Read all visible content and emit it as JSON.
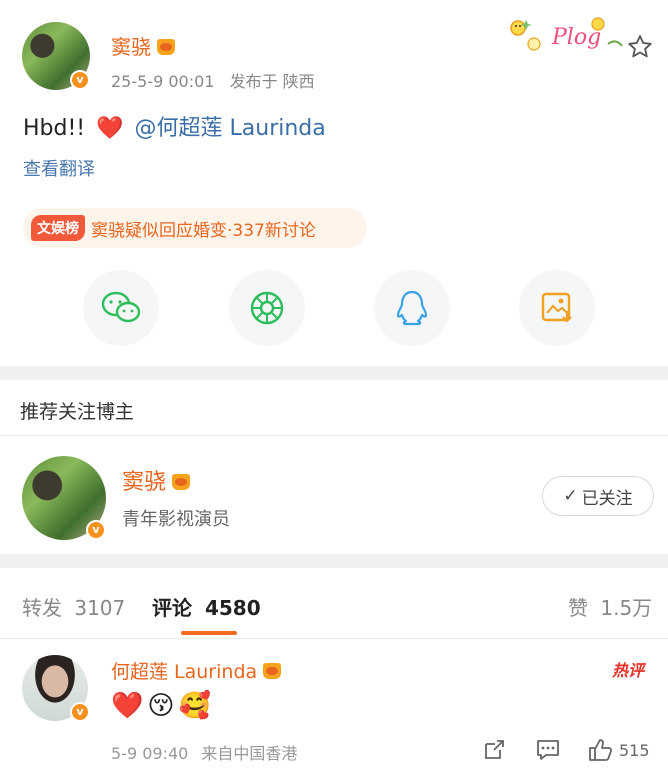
{
  "post": {
    "author_name": "窦骁",
    "time": "25-5-9 00:01",
    "location": "发布于 陕西",
    "content_text": "Hbd!!",
    "heart_glyph": "❤️",
    "mention": "@何超莲 Laurinda",
    "translate_label": "查看翻译",
    "hot_topic_tag": "文娱榜",
    "hot_topic_text": "窦骁疑似回应婚变·337新讨论",
    "verified_badge": "v",
    "sticker_text": "Plog",
    "icons": {
      "star": "star-icon",
      "wechat": "wechat-icon",
      "moments": "moments-icon",
      "qq": "qq-icon",
      "save_image": "save-image-icon"
    }
  },
  "recommend": {
    "title": "推荐关注博主",
    "blogger_name": "窦骁",
    "blogger_desc": "青年影视演员",
    "follow_label": "已关注",
    "check_glyph": "✓"
  },
  "tabs": {
    "repost_label": "转发",
    "repost_count": "3107",
    "comment_label": "评论",
    "comment_count": "4580",
    "like_label": "赞",
    "like_count": "1.5万"
  },
  "comment": {
    "author_name": "何超莲 Laurinda",
    "hot_badge": "热评",
    "emoji": [
      "❤️",
      "😚",
      "🥰"
    ],
    "time": "5-9 09:40",
    "source": "来自中国香港",
    "like_count": "515"
  },
  "colors": {
    "accent_orange": "#e8651e",
    "link_blue": "#3a6ea8",
    "wechat_green": "#2dbd5a",
    "qq_blue": "#3aa2e6",
    "tab_underline": "#f26b22",
    "hot_red": "#e5332a"
  }
}
